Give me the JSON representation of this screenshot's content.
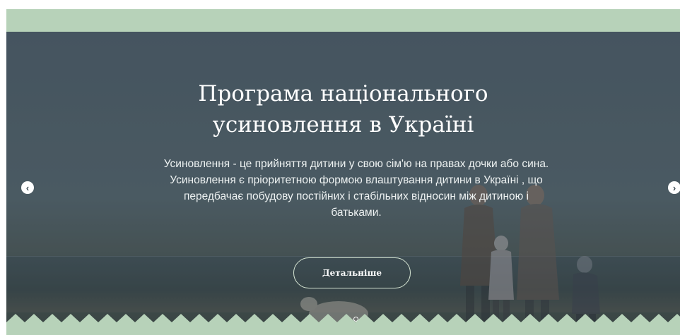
{
  "colors": {
    "band": "#b7d2b9",
    "hero_overlay": "#4f5f6c",
    "text": "#ffffff",
    "button_border": "#d7e6d4"
  },
  "hero": {
    "title_line1": "Програма національного",
    "title_line2": "усиновлення в Україні",
    "description_line1": "Усиновлення - це прийняття дитини у свою сім'ю на правах дочки або сина.",
    "description_line2": "Усиновлення є пріоритетною формою влаштування дитини в Україні , що",
    "description_line3": "передбачає побудову постійних і стабільних відносин між дитиною і",
    "description_line4": "батьками.",
    "cta_label": "Детальніше"
  },
  "carousel": {
    "prev_icon": "chevron-left-icon",
    "next_icon": "chevron-right-icon",
    "prev_glyph": "‹",
    "next_glyph": "›",
    "slides_total": 2,
    "active_slide": 1
  }
}
